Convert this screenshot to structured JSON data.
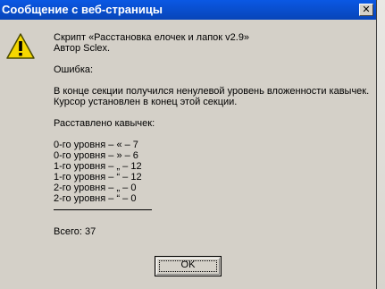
{
  "window": {
    "title": "Сообщение с веб-страницы",
    "close_glyph": "✕"
  },
  "icon": "warning-icon",
  "message": {
    "line1": "Скрипт «Расстановка елочек и лапок v2.9»",
    "line2": "Автор Sclex.",
    "line3": "Ошибка:",
    "line4": "В конце секции получился ненулевой уровень вложенности кавычек.",
    "line5": "Курсор установлен в конец этой секции.",
    "line6": "Расставлено кавычек:",
    "counts": [
      "0-го уровня – « – 7",
      "0-го уровня – » – 6",
      "1-го уровня – „ – 12",
      "1-го уровня – “ – 12",
      "2-го уровня – „ – 0",
      "2-го уровня – “ – 0"
    ],
    "total": "Всего: 37"
  },
  "buttons": {
    "ok_label": "OK"
  },
  "colors": {
    "titlebar": "#0a58e4",
    "dialog_bg": "#d4d0c8",
    "desktop": "#0b7a2b"
  }
}
